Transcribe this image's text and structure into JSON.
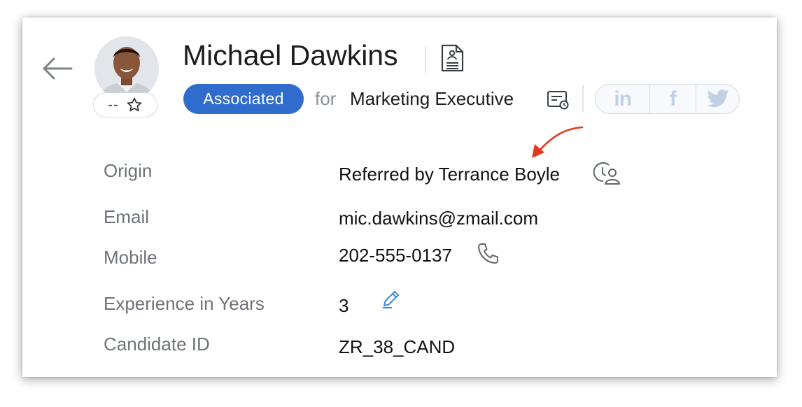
{
  "candidate": {
    "name": "Michael Dawkins",
    "rating": "--",
    "status": "Associated",
    "for_label": "for",
    "job_title": "Marketing Executive"
  },
  "social": {
    "linkedin_label": "in",
    "facebook_label": "f"
  },
  "fields": [
    {
      "label": "Origin",
      "value": "Referred by Terrance Boyle"
    },
    {
      "label": "Email",
      "value": "mic.dawkins@zmail.com"
    },
    {
      "label": "Mobile",
      "value": "202-555-0137"
    },
    {
      "label": "Experience in Years",
      "value": "3"
    },
    {
      "label": "Candidate ID",
      "value": "ZR_38_CAND"
    }
  ],
  "icons": {
    "back": "back-arrow-icon",
    "star": "star-icon",
    "resume": "resume-document-icon",
    "job": "job-opening-icon",
    "linkedin": "linkedin-icon",
    "facebook": "facebook-icon",
    "twitter": "twitter-icon",
    "referral": "referral-history-icon",
    "phone": "phone-icon",
    "edit": "pencil-edit-icon",
    "annotation": "annotation-arrow"
  },
  "colors": {
    "status_badge": "#2f6ccc",
    "social_icon": "#c2d0e3",
    "edit_icon": "#3d8ae0",
    "annotation_arrow": "#e5391f",
    "label_text": "#6e7378"
  }
}
